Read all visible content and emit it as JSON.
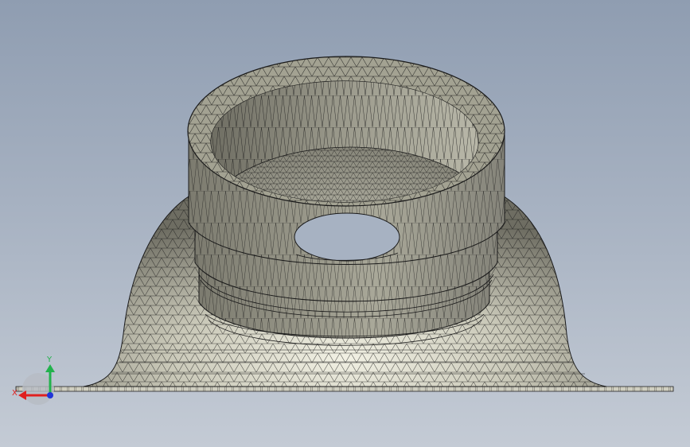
{
  "viewport": {
    "background_top": "#8f9db1",
    "background_bottom": "#c4cbd5",
    "render_mode": "shaded-with-mesh-edges"
  },
  "model": {
    "description_icon": "meshed-cad-part-icon",
    "face_color": "#a3a292",
    "edge_color": "#1a1a1a"
  },
  "triad": {
    "x_label": "X",
    "y_label": "Y",
    "x_color": "#e0201f",
    "y_color": "#22b24c",
    "z_color": "#2035d8"
  }
}
